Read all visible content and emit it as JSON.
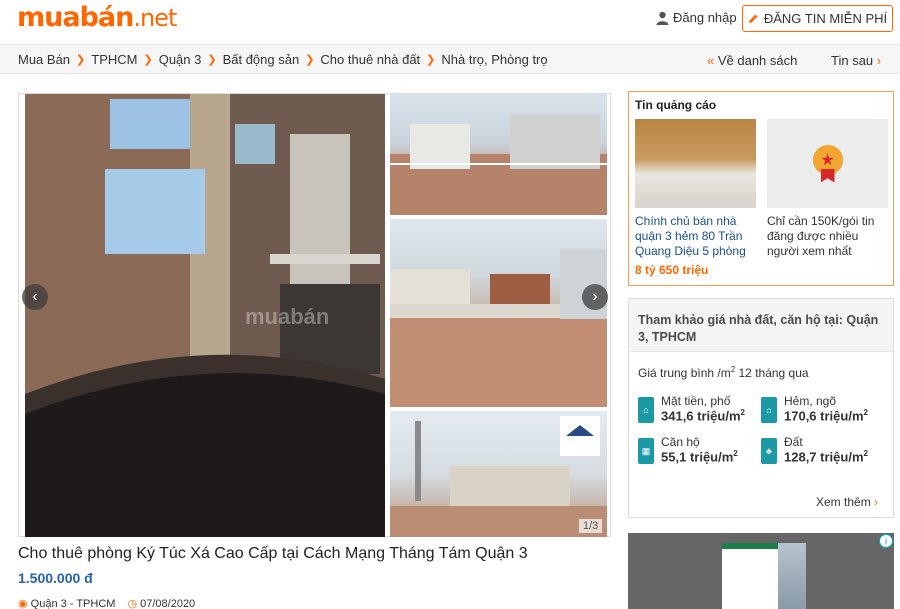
{
  "header": {
    "logo_main": "muabán",
    "logo_tld": ".net",
    "login_label": "Đăng nhập",
    "post_button_label": "ĐĂNG TIN MIỄN PHÍ"
  },
  "breadcrumb": {
    "items": [
      "Mua Bán",
      "TPHCM",
      "Quận 3",
      "Bất động sản",
      "Cho thuê nhà đất",
      "Nhà trọ, Phòng trọ"
    ],
    "back_to_list": "Về danh sách",
    "next_ad": "Tin sau"
  },
  "gallery": {
    "watermark": "muabán",
    "counter": "1/3",
    "prev_icon": "chevron-left-icon",
    "next_icon": "chevron-right-icon"
  },
  "listing": {
    "title": "Cho thuê phòng Ký Túc Xá Cao Cấp tại Cách Mạng Tháng Tám Quận 3",
    "price": "1.500.000 đ",
    "location": "Quận 3 - TPHCM",
    "date": "07/08/2020"
  },
  "ads": {
    "title": "Tin quảng cáo",
    "items": [
      {
        "text": "Chính chủ bán nhà quận 3 hẻm 80 Trần Quang Diệu 5 phòng",
        "price": "8 tỷ 650 triệu"
      },
      {
        "text": "Chỉ cần 150K/gói tin đăng được nhiều người xem nhất",
        "price": ""
      }
    ]
  },
  "price_reference": {
    "heading": "Tham khảo giá nhà đất, căn hộ tại: Quận 3, TPHCM",
    "subtitle_prefix": "Giá trung bình /m",
    "subtitle_sup": "2",
    "subtitle_suffix": " 12 tháng qua",
    "unit": "triệu/m",
    "unit_sup": "2",
    "items": [
      {
        "label": "Mặt tiền, phố",
        "value": "341,6"
      },
      {
        "label": "Hẻm, ngõ",
        "value": "170,6"
      },
      {
        "label": "Căn hộ",
        "value": "55,1"
      },
      {
        "label": "Đất",
        "value": "128,7"
      }
    ],
    "more_label": "Xem thêm"
  },
  "colors": {
    "brand": "#ff6600",
    "price_blue": "#2463a6",
    "teal_icon": "#1b9aa5"
  }
}
